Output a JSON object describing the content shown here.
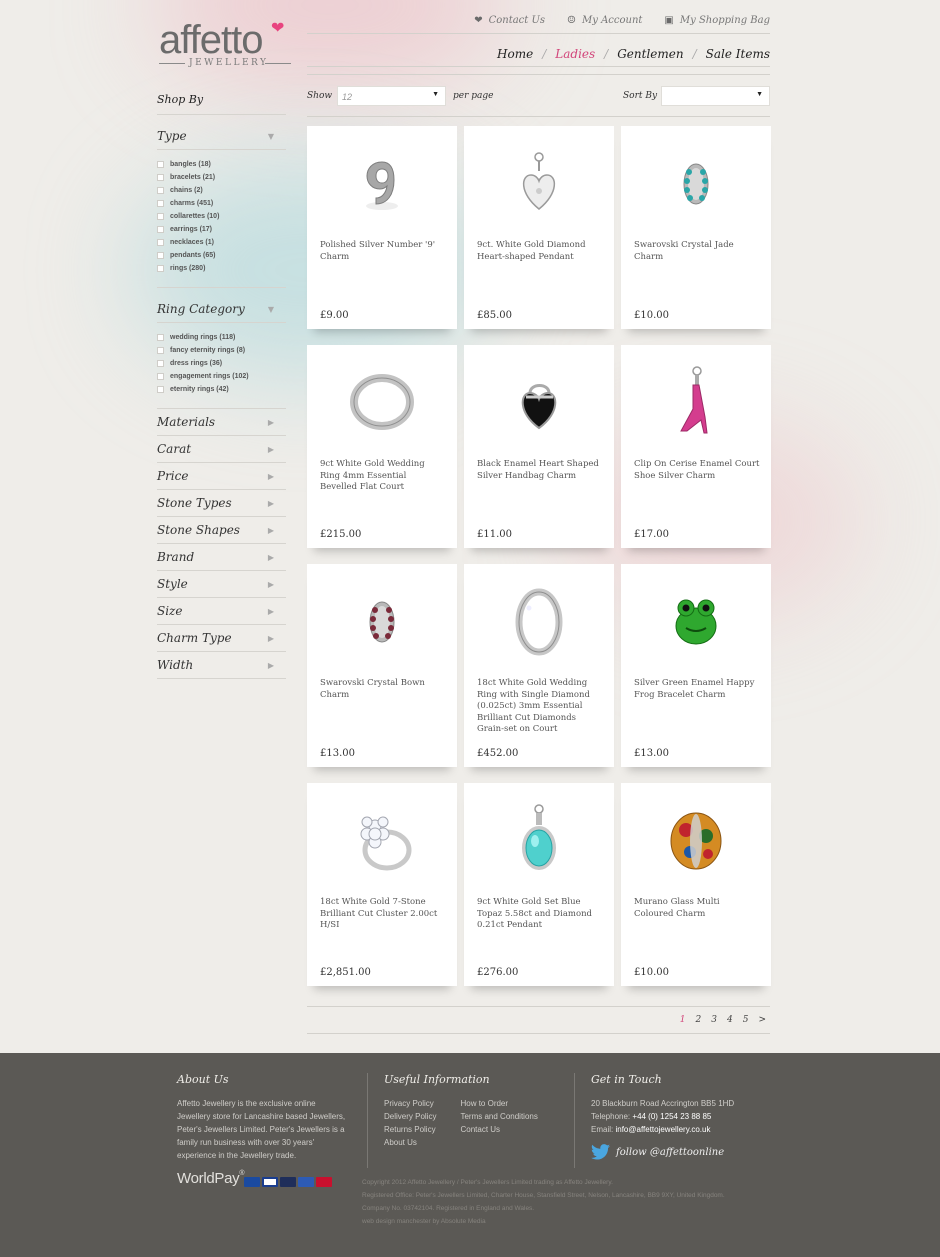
{
  "brand": {
    "name": "affetto",
    "sub": "JEWELLERY"
  },
  "utility": {
    "contact": "Contact Us",
    "account": "My Account",
    "bag": "My Shopping Bag"
  },
  "nav": [
    "Home",
    "Ladies",
    "Gentlemen",
    "Sale Items"
  ],
  "nav_active": "Ladies",
  "sidebar": {
    "title": "Shop By",
    "type": {
      "label": "Type",
      "options": [
        "bangles (18)",
        "bracelets (21)",
        "chains (2)",
        "charms (451)",
        "collarettes (10)",
        "earrings (17)",
        "necklaces (1)",
        "pendants (65)",
        "rings (280)"
      ]
    },
    "ring_category": {
      "label": "Ring Category",
      "options": [
        "wedding rings (118)",
        "fancy eternity rings (8)",
        "dress rings (36)",
        "engagement rings (102)",
        "eternity rings (42)"
      ]
    },
    "collapsed": [
      "Materials",
      "Carat",
      "Price",
      "Stone Types",
      "Stone Shapes",
      "Brand",
      "Style",
      "Size",
      "Charm Type",
      "Width"
    ]
  },
  "toolbar": {
    "show_label": "Show",
    "show_value": "12",
    "per_page": "per page",
    "sort_label": "Sort By",
    "sort_value": ""
  },
  "products": [
    {
      "name": "Polished Silver Number '9' Charm",
      "price": "£9.00",
      "icon": "number-nine-charm"
    },
    {
      "name": "9ct. White Gold Diamond Heart-shaped Pendant",
      "price": "£85.00",
      "icon": "heart-pendant"
    },
    {
      "name": "Swarovski Crystal Jade Charm",
      "price": "£10.00",
      "icon": "bead-charm"
    },
    {
      "name": "9ct White Gold Wedding Ring 4mm Essential Bevelled Flat Court",
      "price": "£215.00",
      "icon": "wedding-ring"
    },
    {
      "name": "Black Enamel Heart Shaped Silver Handbag Charm",
      "price": "£11.00",
      "icon": "handbag-charm"
    },
    {
      "name": "Clip On Cerise Enamel Court Shoe Silver Charm",
      "price": "£17.00",
      "icon": "shoe-charm"
    },
    {
      "name": "Swarovski Crystal Bown Charm",
      "price": "£13.00",
      "icon": "bead-charm"
    },
    {
      "name": "18ct White Gold Wedding Ring with Single Diamond (0.025ct) 3mm Essential Brilliant Cut Diamonds Grain-set on Court",
      "price": "£452.00",
      "icon": "diamond-ring"
    },
    {
      "name": "Silver Green Enamel Happy Frog Bracelet Charm",
      "price": "£13.00",
      "icon": "frog-charm"
    },
    {
      "name": "18ct White Gold 7-Stone Brilliant Cut Cluster 2.00ct H/SI",
      "price": "£2,851.00",
      "icon": "cluster-ring"
    },
    {
      "name": "9ct White Gold Set Blue Topaz 5.58ct and Diamond 0.21ct Pendant",
      "price": "£276.00",
      "icon": "topaz-pendant"
    },
    {
      "name": "Murano Glass Multi Coloured Charm",
      "price": "£10.00",
      "icon": "murano-bead"
    }
  ],
  "pagination": {
    "pages": [
      "1",
      "2",
      "3",
      "4",
      "5"
    ],
    "current": "1",
    "next": ">"
  },
  "footer": {
    "about": {
      "title": "About Us",
      "text": "Affetto Jewellery is the exclusive online Jewellery store for Lancashire based Jewellers, Peter's Jewellers Limited. Peter's Jewellers is a family run business with over 30 years' experience in the Jewellery trade."
    },
    "info": {
      "title": "Useful Information",
      "col1": [
        "Privacy Policy",
        "Delivery Policy",
        "Returns Policy",
        "About Us"
      ],
      "col2": [
        "How to Order",
        "Terms and Conditions",
        "Contact Us"
      ]
    },
    "contact": {
      "title": "Get in Touch",
      "address": "20 Blackburn Road Accrington BB5 1HD",
      "tel_label": "Telephone:",
      "tel": "+44 (0) 1254 23 88 85",
      "email_label": "Email:",
      "email": "info@affettojewellery.co.uk",
      "follow": "follow",
      "handle": "@affettoonline"
    },
    "worldpay": "WorldPay",
    "copyright": [
      "Copyright 2012 Affetto Jewellery / Peter's Jewellers Limited trading as Affetto Jewellery.",
      "Registered Office: Peter's Jewellers Limited, Charter House, Stansfield Street, Nelson, Lancashire, BB9 9XY, United Kingdom.",
      "Company No. 03742104. Registered in England and Wales.",
      "web design manchester by Absolute Media"
    ]
  },
  "colors": {
    "accent": "#d2457a",
    "footer_bg": "#5b5955",
    "page_bg": "#efede9"
  }
}
